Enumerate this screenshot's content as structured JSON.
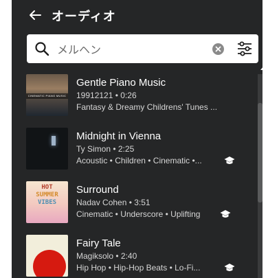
{
  "header": {
    "back_icon": "arrow-left-icon",
    "title": "オーディオ"
  },
  "search": {
    "value": "メルヘン",
    "placeholder": "",
    "search_icon": "magnifier-icon",
    "clear_icon": "clear-x-icon",
    "filter_icon": "sliders-icon"
  },
  "tracks": [
    {
      "title": "Gentle Piano Music",
      "meta": "19912121 • 0:26",
      "tags": "Fantasy & Dreamy Childrens' Tunes ...",
      "thumb_text": "CINEMATIC PIANO MUSIC",
      "education": false
    },
    {
      "title": "Midnight in Vienna",
      "meta": "Ty Simon • 2:25",
      "tags": "Acoustic • Children • Cinematic •...",
      "thumb_text": "",
      "education": true
    },
    {
      "title": "Surround",
      "meta": "Nadav Cohen • 3:51",
      "tags": "Cinematic • Underscore • Uplifting",
      "thumb_text_lines": [
        "HOT",
        "SUMMER",
        "VIBES"
      ],
      "education": true
    },
    {
      "title": "Fairy Tale",
      "meta": "Magiksolo • 2:40",
      "tags": "Hip Hop • Hip-Hop Beats • Lo-Fi...",
      "thumb_text": "",
      "education": true
    }
  ],
  "colors": {
    "panel_bg": "#252627",
    "text_primary": "#ffffff",
    "text_secondary": "#d6d6d6"
  }
}
